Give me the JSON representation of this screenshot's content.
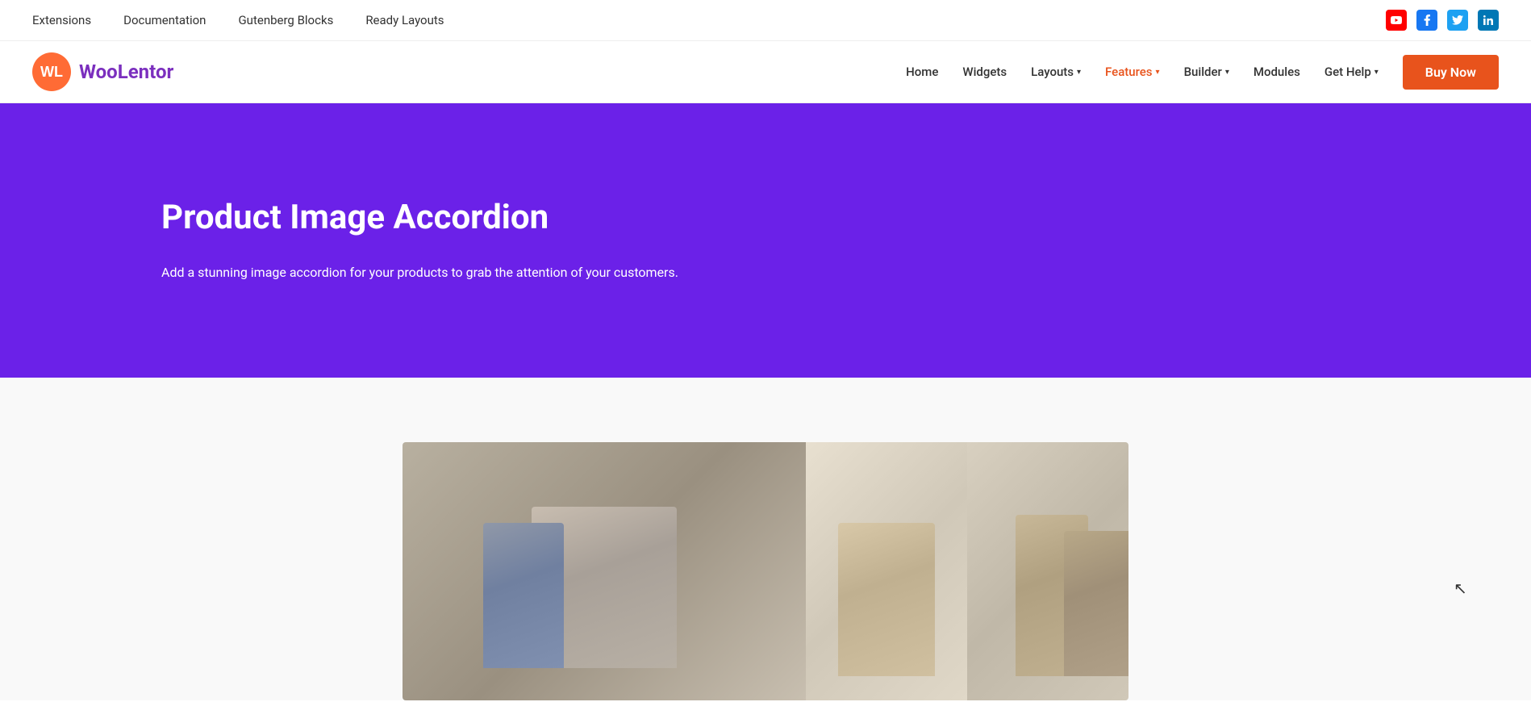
{
  "topbar": {
    "nav_items": [
      {
        "label": "Extensions",
        "href": "#"
      },
      {
        "label": "Documentation",
        "href": "#"
      },
      {
        "label": "Gutenberg Blocks",
        "href": "#"
      },
      {
        "label": "Ready Layouts",
        "href": "#"
      }
    ],
    "social_icons": [
      {
        "name": "youtube",
        "label": "YouTube",
        "color": "#FF0000"
      },
      {
        "name": "facebook",
        "label": "Facebook",
        "color": "#1877F2"
      },
      {
        "name": "twitter",
        "label": "Twitter",
        "color": "#1DA1F2"
      },
      {
        "name": "linkedin",
        "label": "LinkedIn",
        "color": "#0077B5"
      }
    ]
  },
  "mainnav": {
    "logo_woo": "Woo",
    "logo_lentor": "Lentor",
    "nav_items": [
      {
        "label": "Home",
        "href": "#",
        "active": false,
        "has_dropdown": false
      },
      {
        "label": "Widgets",
        "href": "#",
        "active": false,
        "has_dropdown": false
      },
      {
        "label": "Layouts",
        "href": "#",
        "active": false,
        "has_dropdown": true
      },
      {
        "label": "Features",
        "href": "#",
        "active": true,
        "has_dropdown": true
      },
      {
        "label": "Builder",
        "href": "#",
        "active": false,
        "has_dropdown": true
      },
      {
        "label": "Modules",
        "href": "#",
        "active": false,
        "has_dropdown": false
      },
      {
        "label": "Get Help",
        "href": "#",
        "active": false,
        "has_dropdown": true
      }
    ],
    "buy_button_label": "Buy Now"
  },
  "hero": {
    "title": "Product Image Accordion",
    "description": "Add a stunning image accordion for your products to grab the attention of your customers.",
    "bg_color": "#6B21E8"
  },
  "content": {
    "bg_color": "#f9f9f9"
  }
}
